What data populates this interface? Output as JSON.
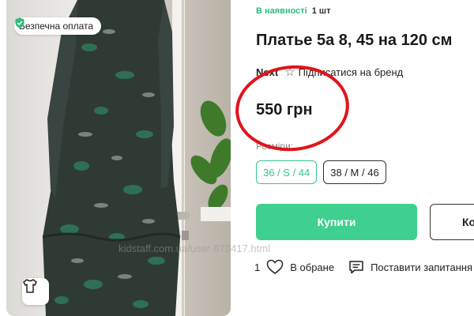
{
  "photo": {
    "badge_label": "Безпечна оплата",
    "badge_icon": "shield-check-icon",
    "tshirt_icon": "tshirt-icon",
    "accent": "#2ebc7c"
  },
  "availability": {
    "status": "В наявності",
    "quantity": "1 шт"
  },
  "product": {
    "title": "Платье 5а 8, 45 на 120 см",
    "brand": "Next",
    "subscribe_label": "Підписатися на бренд",
    "price": "550 грн"
  },
  "sizes": {
    "label": "Розміри:",
    "options": [
      {
        "label": "36 / S / 44",
        "selected": true
      },
      {
        "label": "38 / M / 46",
        "selected": false
      }
    ]
  },
  "buttons": {
    "buy": "Купити",
    "second_partial": "Ко"
  },
  "actions": {
    "favorite_count": "1",
    "favorite_label": "В обране",
    "ask_label": "Поставити запитання"
  },
  "watermark": "kidstaff.com.ua/user-870417.html",
  "colors": {
    "buy_button": "#3fcf8e",
    "selected_size": "#37c58a",
    "annotation_circle": "#e0141c"
  }
}
